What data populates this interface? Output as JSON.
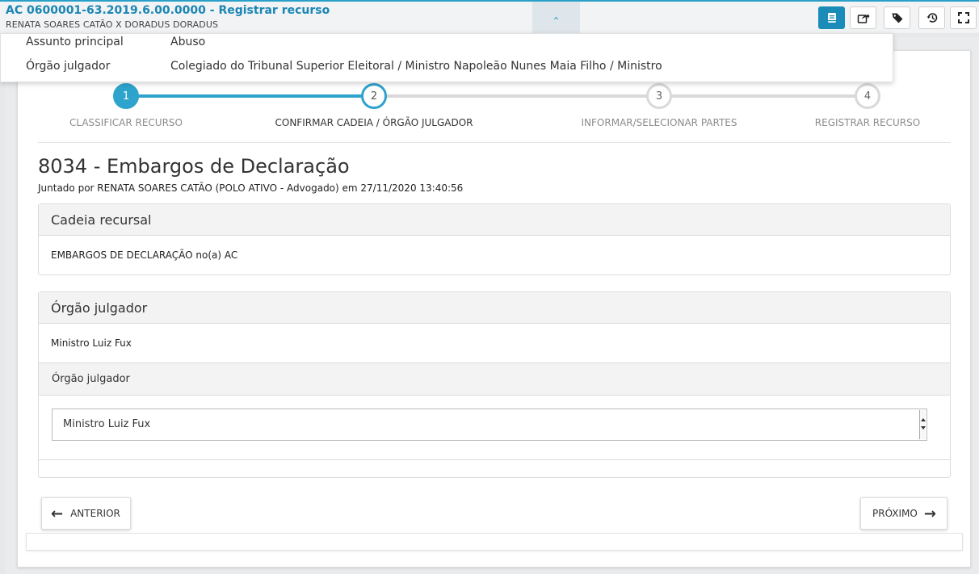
{
  "header": {
    "title": "AC 0600001-63.2019.6.00.0000 - Registrar recurso",
    "subtitle": "RENATA SOARES CATÃO X DORADUS DORADUS",
    "collapse_glyph": "⌃",
    "accent": "#1b86b4"
  },
  "toolbar": {
    "buttons": [
      {
        "icon": "book-icon",
        "active": true
      },
      {
        "icon": "share-icon",
        "active": false
      },
      {
        "icon": "tag-icon",
        "active": false
      },
      {
        "icon": "history-icon",
        "active": false
      },
      {
        "icon": "fullscreen-icon",
        "active": false
      }
    ]
  },
  "details": {
    "rows": [
      {
        "label": "Assunto principal",
        "value": "Abuso"
      },
      {
        "label": "Órgão julgador",
        "value": "Colegiado do Tribunal Superior Eleitoral / Ministro Napoleão Nunes Maia Filho / Ministro"
      }
    ]
  },
  "stepper": {
    "steps": [
      {
        "number": "1",
        "label": "CLASSIFICAR RECURSO",
        "state": "done"
      },
      {
        "number": "2",
        "label": "CONFIRMAR CADEIA / ÓRGÃO JULGADOR",
        "state": "current"
      },
      {
        "number": "3",
        "label": "INFORMAR/SELECIONAR PARTES",
        "state": "pending"
      },
      {
        "number": "4",
        "label": "REGISTRAR RECURSO",
        "state": "pending"
      }
    ],
    "colors": {
      "active": "#2ea3cc",
      "inactive": "#d9d9d9"
    }
  },
  "document": {
    "title": "8034 - Embargos de Declaração",
    "subtitle": "Juntado por RENATA SOARES CATÃO (POLO ATIVO - Advogado) em 27/11/2020 13:40:56"
  },
  "cadeia": {
    "heading": "Cadeia recursal",
    "text": "EMBARGOS DE DECLARAÇÃO no(a) AC"
  },
  "orgao": {
    "heading": "Órgão julgador",
    "text": "Ministro Luiz Fux",
    "sub_heading": "Órgão julgador",
    "selected": "Ministro Luiz Fux"
  },
  "nav": {
    "prev_label": "ANTERIOR",
    "next_label": "PRÓXIMO"
  }
}
